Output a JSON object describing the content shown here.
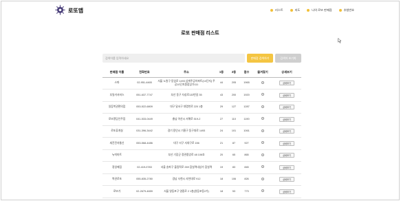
{
  "brand": {
    "name": "로또맵",
    "logo_icon": "lotto-logo-icon"
  },
  "nav": {
    "items": [
      {
        "label": "리스트",
        "icon": "list-icon"
      },
      {
        "label": "지도",
        "icon": "map-icon"
      },
      {
        "label": "나의 로또 판매점",
        "icon": "star-icon"
      },
      {
        "label": "추첨번호",
        "icon": "ball-icon"
      }
    ]
  },
  "page": {
    "title": "로또 판매점 리스트"
  },
  "search": {
    "placeholder": "검색어를 입력하세요",
    "search_label": "판매점 검색하기",
    "reset_label": "검색어 초기화"
  },
  "table": {
    "headers": [
      "판매점 이름",
      "전화번호",
      "주소",
      "1등",
      "2등",
      "점수",
      "즐겨찾기",
      "상세보기"
    ],
    "detail_label": "상세보기",
    "rows": [
      {
        "name": "스파",
        "phone": "02-951-4465",
        "address": "서울 노원구 동일로 1493 상계주공아파트(10단지) 주공10단지종합상가111",
        "first": "44",
        "second": "205",
        "score": "1965"
      },
      {
        "name": "부일카서비스",
        "phone": "051-637-7747",
        "address": "부산 동구 자성로133번길 35",
        "first": "43",
        "second": "200",
        "score": "1920"
      },
      {
        "name": "일등복권편의점",
        "phone": "053-522-6809",
        "address": "대구 달서구 대명천로 220 1층",
        "first": "29",
        "second": "127",
        "score": "1287"
      },
      {
        "name": "로또명당인주점",
        "phone": "041-533-0449",
        "address": "충남 아산시 서해로 519-2",
        "first": "27",
        "second": "110",
        "score": "1190"
      },
      {
        "name": "로또휴게실",
        "phone": "031-396-3442",
        "address": "경기 용인시 기흥구 동구대로 1493",
        "first": "24",
        "second": "101",
        "score": "1061"
      },
      {
        "name": "세진전자통신",
        "phone": "053-568-4486",
        "address": "대구 서구 서대구로 156",
        "first": "21",
        "second": "87",
        "score": "927"
      },
      {
        "name": "뉴빅마트",
        "phone": "",
        "address": "부산 기장군 정관중앙로 48 106호",
        "first": "20",
        "second": "65",
        "score": "865"
      },
      {
        "name": "정일매점",
        "phone": "02-419-0783",
        "address": "서울 송파구 올림픽로 269 잠실역내상가 잠실역",
        "first": "19",
        "second": "83",
        "score": "845"
      },
      {
        "name": "복권로또",
        "phone": "055-835-2780",
        "address": "경남 사천시 사천대로 912",
        "first": "18",
        "second": "106",
        "score": "826"
      },
      {
        "name": "로또가",
        "phone": "02-2679-4659",
        "address": "서울 영등포구 영중로 2 1층(영등포동2가)",
        "first": "18",
        "second": "53",
        "score": "773"
      }
    ]
  }
}
